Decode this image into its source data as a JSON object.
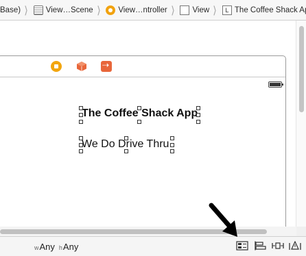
{
  "breadcrumb": [
    {
      "label": "Base)",
      "icon": "none"
    },
    {
      "label": "View…Scene",
      "icon": "scene-icon"
    },
    {
      "label": "View…ntroller",
      "icon": "view-controller-icon"
    },
    {
      "label": "View",
      "icon": "view-icon"
    },
    {
      "label": "The Coffee Shack App",
      "icon": "label-icon",
      "glyph": "L"
    }
  ],
  "scene": {
    "title_label": "The Coffee Shack App",
    "subtitle_label": "We Do Drive Thru"
  },
  "size_class": {
    "w_prefix": "w",
    "w_value": "Any",
    "h_prefix": "h",
    "h_value": "Any"
  },
  "colors": {
    "view_controller": "#f2a50e",
    "first_responder": "#e8663a",
    "exit": "#e8663a"
  }
}
